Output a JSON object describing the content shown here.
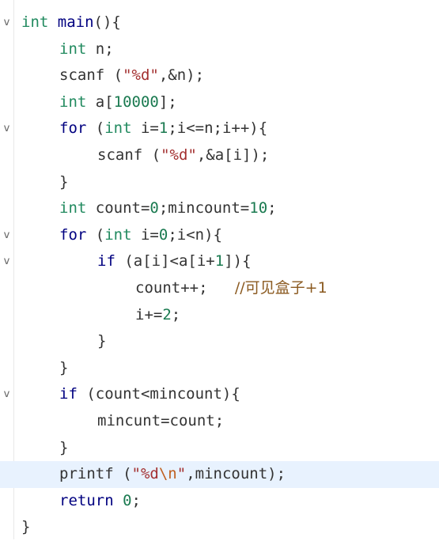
{
  "editor": {
    "fold_glyph": "v",
    "lines": [
      {
        "indent": 0,
        "fold": true,
        "tokens": [
          [
            "ty",
            "int"
          ],
          [
            "plain",
            " "
          ],
          [
            "fn",
            "main"
          ],
          [
            "plain",
            "(){"
          ]
        ]
      },
      {
        "indent": 1,
        "fold": false,
        "tokens": [
          [
            "ty",
            "int"
          ],
          [
            "plain",
            " n;"
          ]
        ]
      },
      {
        "indent": 1,
        "fold": false,
        "tokens": [
          [
            "plain",
            "scanf ("
          ],
          [
            "str",
            "\"%d\""
          ],
          [
            "plain",
            ",&n);"
          ]
        ]
      },
      {
        "indent": 1,
        "fold": false,
        "tokens": [
          [
            "ty",
            "int"
          ],
          [
            "plain",
            " a["
          ],
          [
            "num",
            "10000"
          ],
          [
            "plain",
            "];"
          ]
        ]
      },
      {
        "indent": 1,
        "fold": true,
        "tokens": [
          [
            "kw",
            "for"
          ],
          [
            "plain",
            " ("
          ],
          [
            "ty",
            "int"
          ],
          [
            "plain",
            " i="
          ],
          [
            "num",
            "1"
          ],
          [
            "plain",
            ";i<=n;i++){"
          ]
        ]
      },
      {
        "indent": 2,
        "fold": false,
        "tokens": [
          [
            "plain",
            "scanf ("
          ],
          [
            "str",
            "\"%d\""
          ],
          [
            "plain",
            ",&a[i]);"
          ]
        ]
      },
      {
        "indent": 1,
        "fold": false,
        "tokens": [
          [
            "plain",
            "}"
          ]
        ]
      },
      {
        "indent": 1,
        "fold": false,
        "tokens": [
          [
            "ty",
            "int"
          ],
          [
            "plain",
            " count="
          ],
          [
            "num",
            "0"
          ],
          [
            "plain",
            ";mincount="
          ],
          [
            "num",
            "10"
          ],
          [
            "plain",
            ";"
          ]
        ]
      },
      {
        "indent": 1,
        "fold": true,
        "tokens": [
          [
            "kw",
            "for"
          ],
          [
            "plain",
            " ("
          ],
          [
            "ty",
            "int"
          ],
          [
            "plain",
            " i="
          ],
          [
            "num",
            "0"
          ],
          [
            "plain",
            ";i<n){"
          ]
        ]
      },
      {
        "indent": 2,
        "fold": true,
        "tokens": [
          [
            "kw",
            "if"
          ],
          [
            "plain",
            " (a[i]<a[i+"
          ],
          [
            "num",
            "1"
          ],
          [
            "plain",
            "]){"
          ]
        ]
      },
      {
        "indent": 3,
        "fold": false,
        "tokens": [
          [
            "plain",
            "count++;   "
          ],
          [
            "cmt",
            "//可见盒子+1"
          ]
        ]
      },
      {
        "indent": 3,
        "fold": false,
        "tokens": [
          [
            "plain",
            "i+="
          ],
          [
            "num",
            "2"
          ],
          [
            "plain",
            ";"
          ]
        ]
      },
      {
        "indent": 2,
        "fold": false,
        "tokens": [
          [
            "plain",
            "}"
          ]
        ]
      },
      {
        "indent": 1,
        "fold": false,
        "tokens": [
          [
            "plain",
            "}"
          ]
        ]
      },
      {
        "indent": 1,
        "fold": true,
        "tokens": [
          [
            "kw",
            "if"
          ],
          [
            "plain",
            " (count<mincount){"
          ]
        ]
      },
      {
        "indent": 2,
        "fold": false,
        "tokens": [
          [
            "plain",
            "mincunt=count;"
          ]
        ]
      },
      {
        "indent": 1,
        "fold": false,
        "tokens": [
          [
            "plain",
            "}"
          ]
        ]
      },
      {
        "indent": 1,
        "fold": false,
        "current": true,
        "tokens": [
          [
            "plain",
            "printf ("
          ],
          [
            "str",
            "\"%d"
          ],
          [
            "esc",
            "\\n"
          ],
          [
            "str",
            "\""
          ],
          [
            "plain",
            ",mincount);"
          ]
        ]
      },
      {
        "indent": 1,
        "fold": false,
        "tokens": [
          [
            "kw",
            "return"
          ],
          [
            "plain",
            " "
          ],
          [
            "num",
            "0"
          ],
          [
            "plain",
            ";"
          ]
        ]
      },
      {
        "indent": 0,
        "fold": false,
        "tokens": [
          [
            "plain",
            "}"
          ]
        ]
      }
    ]
  },
  "colors": {
    "keyword": "#000080",
    "type": "#218a5f",
    "string": "#a33030",
    "number": "#1a7a50",
    "comment": "#8b5a20",
    "current_line_bg": "#e8f2fe"
  }
}
